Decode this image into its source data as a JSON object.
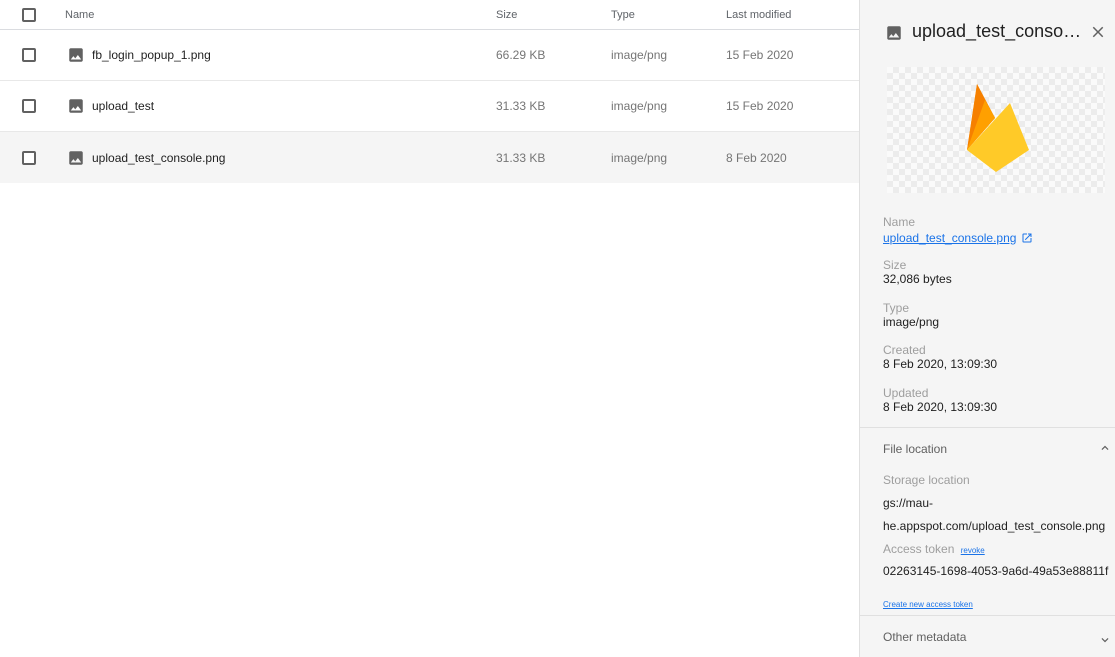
{
  "table": {
    "columns": {
      "name": "Name",
      "size": "Size",
      "type": "Type",
      "modified": "Last modified"
    },
    "rows": [
      {
        "name": "fb_login_popup_1.png",
        "size": "66.29 KB",
        "type": "image/png",
        "modified": "15 Feb 2020"
      },
      {
        "name": "upload_test",
        "size": "31.33 KB",
        "type": "image/png",
        "modified": "15 Feb 2020"
      },
      {
        "name": "upload_test_console.png",
        "size": "31.33 KB",
        "type": "image/png",
        "modified": "8 Feb 2020"
      }
    ]
  },
  "panel": {
    "title": "upload_test_console.png",
    "name_label": "Name",
    "name_value": "upload_test_console.png",
    "size_label": "Size",
    "size_value": "32,086 bytes",
    "type_label": "Type",
    "type_value": "image/png",
    "created_label": "Created",
    "created_value": "8 Feb 2020, 13:09:30",
    "updated_label": "Updated",
    "updated_value": "8 Feb 2020, 13:09:30",
    "file_location_label": "File location",
    "storage_location_label": "Storage location",
    "storage_location_value": "gs://mau-he.appspot.com/upload_test_console.png",
    "access_token_label": "Access token",
    "revoke_label": "revoke",
    "access_token_value": "02263145-1698-4053-9a6d-49a53e88811f",
    "create_token_label": "Create new access token",
    "other_metadata_label": "Other metadata"
  },
  "colors": {
    "link": "#1a73e8",
    "panel_bg": "#f5f5f5",
    "firebase_yellow": "#ffca28",
    "firebase_orange": "#f57c00"
  },
  "icons": {
    "file": "image-icon",
    "close": "close-icon",
    "external": "open-in-new-icon",
    "expand": "chevron-up-icon",
    "collapse": "chevron-down-icon"
  }
}
